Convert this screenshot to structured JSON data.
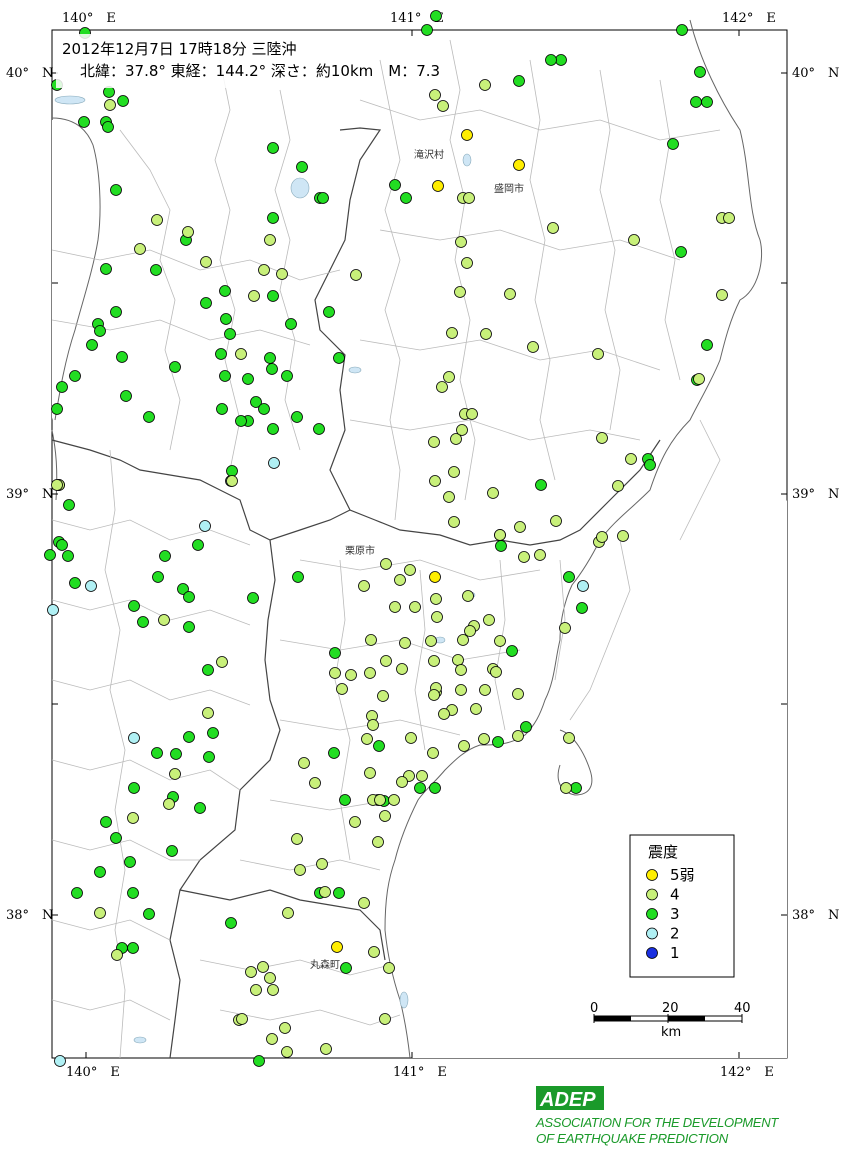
{
  "header": {
    "line1": "2012年12月7日 17時18分 三陸沖",
    "line2": "北緯：37.8° 東経：144.2° 深さ：約10km　M：7.3"
  },
  "coords": {
    "lon140_top": "140°　E",
    "lon141_top": "141°　E",
    "lon142_top": "142°　E",
    "lon140_bottom": "140°　E",
    "lon141_bottom": "141°　E",
    "lon142_bottom": "142°　E",
    "lat40_left": "40°　N",
    "lat40_right": "40°　N",
    "lat39_left": "39°　N",
    "lat39_right": "39°　N",
    "lat38_left": "38°　N",
    "lat38_right": "38°　N"
  },
  "cities": {
    "takizawa": "滝沢村",
    "morioka": "盛岡市",
    "kurihara": "栗原市",
    "marumori": "丸森町"
  },
  "legend": {
    "title": "震度",
    "items": [
      {
        "label": "5弱",
        "color": "#ffee00"
      },
      {
        "label": "4",
        "color": "#c8f07a"
      },
      {
        "label": "3",
        "color": "#22dd22"
      },
      {
        "label": "2",
        "color": "#b0f0f4"
      },
      {
        "label": "1",
        "color": "#1a2fe0"
      }
    ]
  },
  "scale": {
    "t0": "0",
    "t20": "20",
    "t40": "40",
    "unit": "km"
  },
  "logo": {
    "mark": "ADEP",
    "line1": "ASSOCIATION FOR THE DEVELOPMENT",
    "line2": "OF EARTHQUAKE PREDICTION"
  },
  "colors": {
    "i5": "#ffee00",
    "i4": "#c8f07a",
    "i3": "#22dd22",
    "i2": "#b0f0f4",
    "i1": "#1a2fe0",
    "water": "#cfe6f5",
    "logo_green": "#1a9a2a"
  },
  "stations": {
    "i5": [
      [
        467,
        135
      ],
      [
        519,
        165
      ],
      [
        438,
        186
      ],
      [
        435,
        577
      ],
      [
        337,
        947
      ]
    ],
    "i4": [
      [
        110,
        105
      ],
      [
        157,
        220
      ],
      [
        140,
        249
      ],
      [
        188,
        232
      ],
      [
        206,
        262
      ],
      [
        254,
        296
      ],
      [
        270,
        240
      ],
      [
        264,
        270
      ],
      [
        282,
        274
      ],
      [
        241,
        354
      ],
      [
        356,
        275
      ],
      [
        435,
        95
      ],
      [
        443,
        106
      ],
      [
        485,
        85
      ],
      [
        463,
        198
      ],
      [
        469,
        198
      ],
      [
        461,
        242
      ],
      [
        467,
        263
      ],
      [
        460,
        292
      ],
      [
        510,
        294
      ],
      [
        486,
        334
      ],
      [
        452,
        333
      ],
      [
        533,
        347
      ],
      [
        598,
        354
      ],
      [
        442,
        387
      ],
      [
        449,
        377
      ],
      [
        465,
        414
      ],
      [
        472,
        414
      ],
      [
        456,
        439
      ],
      [
        462,
        430
      ],
      [
        434,
        442
      ],
      [
        454,
        472
      ],
      [
        435,
        481
      ],
      [
        449,
        497
      ],
      [
        454,
        522
      ],
      [
        493,
        493
      ],
      [
        520,
        527
      ],
      [
        556,
        521
      ],
      [
        500,
        535
      ],
      [
        524,
        557
      ],
      [
        540,
        555
      ],
      [
        599,
        542
      ],
      [
        602,
        537
      ],
      [
        623,
        536
      ],
      [
        618,
        486
      ],
      [
        631,
        459
      ],
      [
        602,
        438
      ],
      [
        553,
        228
      ],
      [
        634,
        240
      ],
      [
        722,
        218
      ],
      [
        729,
        218
      ],
      [
        722,
        295
      ],
      [
        699,
        379
      ],
      [
        232,
        481
      ],
      [
        59,
        485
      ],
      [
        57,
        485
      ],
      [
        164,
        620
      ],
      [
        222,
        662
      ],
      [
        208,
        713
      ],
      [
        175,
        774
      ],
      [
        364,
        586
      ],
      [
        386,
        564
      ],
      [
        400,
        580
      ],
      [
        410,
        570
      ],
      [
        395,
        607
      ],
      [
        415,
        607
      ],
      [
        436,
        599
      ],
      [
        468,
        596
      ],
      [
        474,
        626
      ],
      [
        489,
        620
      ],
      [
        470,
        631
      ],
      [
        463,
        640
      ],
      [
        437,
        617
      ],
      [
        431,
        641
      ],
      [
        405,
        643
      ],
      [
        434,
        661
      ],
      [
        402,
        669
      ],
      [
        458,
        660
      ],
      [
        461,
        670
      ],
      [
        436,
        692
      ],
      [
        436,
        688
      ],
      [
        461,
        690
      ],
      [
        434,
        695
      ],
      [
        452,
        710
      ],
      [
        444,
        714
      ],
      [
        476,
        709
      ],
      [
        485,
        690
      ],
      [
        493,
        669
      ],
      [
        496,
        672
      ],
      [
        500,
        641
      ],
      [
        518,
        694
      ],
      [
        518,
        736
      ],
      [
        464,
        746
      ],
      [
        484,
        739
      ],
      [
        411,
        738
      ],
      [
        433,
        753
      ],
      [
        386,
        661
      ],
      [
        371,
        640
      ],
      [
        335,
        673
      ],
      [
        351,
        675
      ],
      [
        342,
        689
      ],
      [
        370,
        673
      ],
      [
        383,
        696
      ],
      [
        372,
        716
      ],
      [
        373,
        725
      ],
      [
        367,
        739
      ],
      [
        370,
        773
      ],
      [
        409,
        776
      ],
      [
        402,
        782
      ],
      [
        422,
        776
      ],
      [
        373,
        800
      ],
      [
        394,
        800
      ],
      [
        380,
        800
      ],
      [
        355,
        822
      ],
      [
        385,
        816
      ],
      [
        378,
        842
      ],
      [
        297,
        839
      ],
      [
        300,
        870
      ],
      [
        322,
        864
      ],
      [
        325,
        892
      ],
      [
        364,
        903
      ],
      [
        288,
        913
      ],
      [
        239,
        1020
      ],
      [
        242,
        1019
      ],
      [
        251,
        972
      ],
      [
        263,
        967
      ],
      [
        270,
        978
      ],
      [
        256,
        990
      ],
      [
        273,
        990
      ],
      [
        285,
        1028
      ],
      [
        272,
        1039
      ],
      [
        287,
        1052
      ],
      [
        326,
        1049
      ],
      [
        385,
        1019
      ],
      [
        389,
        968
      ],
      [
        304,
        763
      ],
      [
        315,
        783
      ],
      [
        374,
        952
      ],
      [
        100,
        913
      ],
      [
        117,
        955
      ],
      [
        133,
        818
      ],
      [
        169,
        804
      ],
      [
        569,
        738
      ],
      [
        566,
        788
      ],
      [
        565,
        628
      ]
    ],
    "i3": [
      [
        57,
        85
      ],
      [
        85,
        33
      ],
      [
        109,
        92
      ],
      [
        123,
        101
      ],
      [
        84,
        122
      ],
      [
        106,
        122
      ],
      [
        108,
        127
      ],
      [
        116,
        190
      ],
      [
        106,
        269
      ],
      [
        116,
        312
      ],
      [
        98,
        324
      ],
      [
        100,
        331
      ],
      [
        92,
        345
      ],
      [
        122,
        357
      ],
      [
        75,
        376
      ],
      [
        62,
        387
      ],
      [
        57,
        409
      ],
      [
        126,
        396
      ],
      [
        149,
        417
      ],
      [
        156,
        270
      ],
      [
        175,
        367
      ],
      [
        186,
        240
      ],
      [
        273,
        148
      ],
      [
        302,
        167
      ],
      [
        320,
        198
      ],
      [
        323,
        198
      ],
      [
        273,
        218
      ],
      [
        206,
        303
      ],
      [
        225,
        291
      ],
      [
        226,
        319
      ],
      [
        230,
        334
      ],
      [
        221,
        354
      ],
      [
        225,
        376
      ],
      [
        248,
        379
      ],
      [
        270,
        358
      ],
      [
        272,
        369
      ],
      [
        287,
        376
      ],
      [
        256,
        402
      ],
      [
        264,
        409
      ],
      [
        248,
        421
      ],
      [
        241,
        421
      ],
      [
        222,
        409
      ],
      [
        273,
        429
      ],
      [
        297,
        417
      ],
      [
        319,
        429
      ],
      [
        329,
        312
      ],
      [
        339,
        358
      ],
      [
        291,
        324
      ],
      [
        273,
        296
      ],
      [
        395,
        185
      ],
      [
        406,
        198
      ],
      [
        436,
        16
      ],
      [
        561,
        60
      ],
      [
        551,
        60
      ],
      [
        519,
        81
      ],
      [
        673,
        144
      ],
      [
        681,
        252
      ],
      [
        682,
        30
      ],
      [
        700,
        72
      ],
      [
        696,
        102
      ],
      [
        707,
        102
      ],
      [
        707,
        345
      ],
      [
        697,
        380
      ],
      [
        648,
        459
      ],
      [
        650,
        465
      ],
      [
        541,
        485
      ],
      [
        500,
        535
      ],
      [
        427,
        30
      ],
      [
        59,
        485
      ],
      [
        69,
        505
      ],
      [
        59,
        542
      ],
      [
        62,
        545
      ],
      [
        50,
        555
      ],
      [
        75,
        583
      ],
      [
        68,
        556
      ],
      [
        165,
        556
      ],
      [
        158,
        577
      ],
      [
        183,
        589
      ],
      [
        189,
        597
      ],
      [
        198,
        545
      ],
      [
        134,
        606
      ],
      [
        189,
        627
      ],
      [
        143,
        622
      ],
      [
        208,
        670
      ],
      [
        253,
        598
      ],
      [
        298,
        577
      ],
      [
        335,
        653
      ],
      [
        334,
        753
      ],
      [
        379,
        746
      ],
      [
        157,
        753
      ],
      [
        176,
        754
      ],
      [
        189,
        737
      ],
      [
        213,
        733
      ],
      [
        209,
        757
      ],
      [
        134,
        788
      ],
      [
        173,
        797
      ],
      [
        200,
        808
      ],
      [
        106,
        822
      ],
      [
        116,
        838
      ],
      [
        100,
        872
      ],
      [
        130,
        862
      ],
      [
        172,
        851
      ],
      [
        77,
        893
      ],
      [
        133,
        893
      ],
      [
        149,
        914
      ],
      [
        122,
        948
      ],
      [
        133,
        948
      ],
      [
        231,
        923
      ],
      [
        320,
        893
      ],
      [
        339,
        893
      ],
      [
        346,
        968
      ],
      [
        378,
        800
      ],
      [
        384,
        801
      ],
      [
        435,
        788
      ],
      [
        420,
        788
      ],
      [
        345,
        800
      ],
      [
        526,
        727
      ],
      [
        498,
        742
      ],
      [
        512,
        651
      ],
      [
        501,
        546
      ],
      [
        569,
        577
      ],
      [
        576,
        788
      ],
      [
        582,
        608
      ],
      [
        232,
        471
      ],
      [
        259,
        1061
      ]
    ],
    "i2": [
      [
        274,
        463
      ],
      [
        231,
        481
      ],
      [
        205,
        526
      ],
      [
        91,
        586
      ],
      [
        53,
        610
      ],
      [
        134,
        738
      ],
      [
        583,
        586
      ],
      [
        60,
        1061
      ]
    ],
    "i1": []
  }
}
